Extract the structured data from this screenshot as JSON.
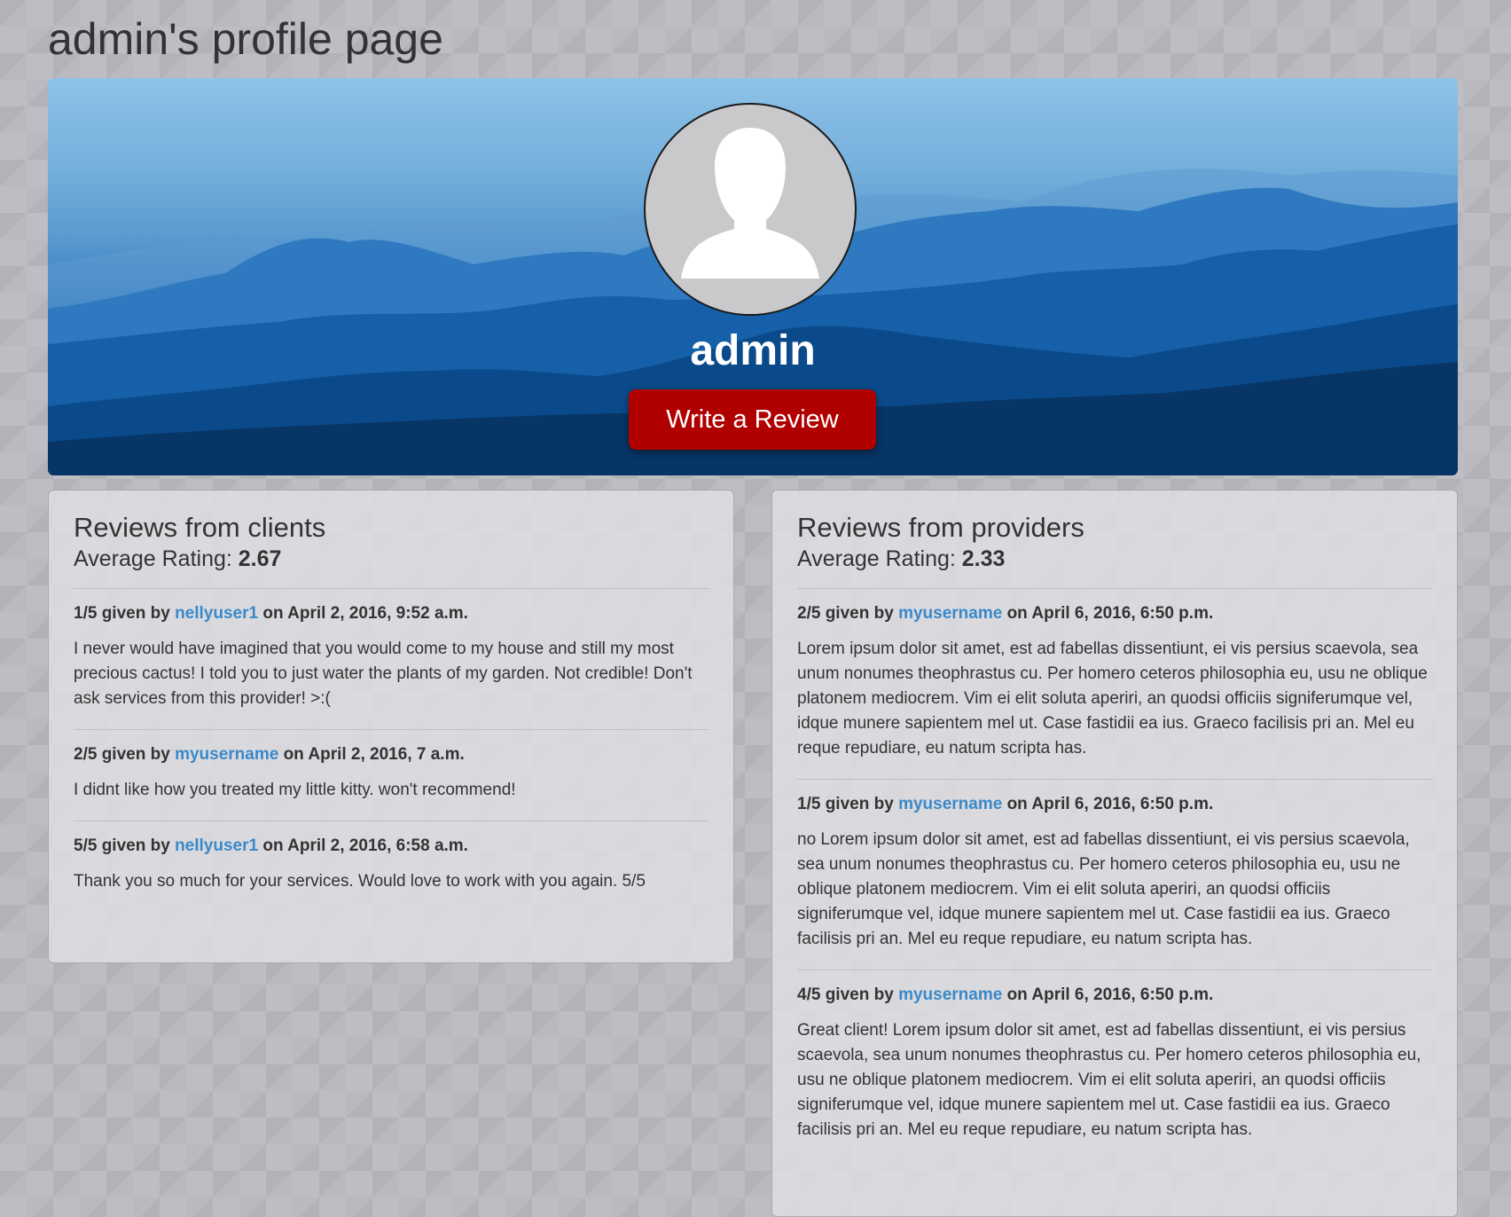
{
  "page": {
    "title": "admin's profile page"
  },
  "profile": {
    "username": "admin",
    "write_review_label": "Write a Review"
  },
  "colors": {
    "accent_button": "#b00000",
    "link": "#3a89c9",
    "banner_sky": "#8ec2e7",
    "banner_dark": "#0a3468"
  },
  "icons": {
    "avatar": "user-silhouette-icon"
  },
  "clients": {
    "heading": "Reviews from clients",
    "avg_label": "Average Rating:",
    "avg_value": "2.67",
    "reviews": [
      {
        "rating": "1/5",
        "given_by": "given by",
        "user": "nellyuser1",
        "on": "on April 2, 2016, 9:52 a.m.",
        "text": "I never would have imagined that you would come to my house and still my most precious cactus! I told you to just water the plants of my garden. Not credible! Don't ask services from this provider! >:("
      },
      {
        "rating": "2/5",
        "given_by": "given by",
        "user": "myusername",
        "on": "on April 2, 2016, 7 a.m.",
        "text": "I didnt like how you treated my little kitty. won't recommend!"
      },
      {
        "rating": "5/5",
        "given_by": "given by",
        "user": "nellyuser1",
        "on": "on April 2, 2016, 6:58 a.m.",
        "text": "Thank you so much for your services. Would love to work with you again. 5/5"
      }
    ]
  },
  "providers": {
    "heading": "Reviews from providers",
    "avg_label": "Average Rating:",
    "avg_value": "2.33",
    "reviews": [
      {
        "rating": "2/5",
        "given_by": "given by",
        "user": "myusername",
        "on": "on April 6, 2016, 6:50 p.m.",
        "text": "Lorem ipsum dolor sit amet, est ad fabellas dissentiunt, ei vis persius scaevola, sea unum nonumes theophrastus cu. Per homero ceteros philosophia eu, usu ne oblique platonem mediocrem. Vim ei elit soluta aperiri, an quodsi officiis signiferumque vel, idque munere sapientem mel ut. Case fastidii ea ius. Graeco facilisis pri an. Mel eu reque repudiare, eu natum scripta has."
      },
      {
        "rating": "1/5",
        "given_by": "given by",
        "user": "myusername",
        "on": "on April 6, 2016, 6:50 p.m.",
        "text": "no Lorem ipsum dolor sit amet, est ad fabellas dissentiunt, ei vis persius scaevola, sea unum nonumes theophrastus cu. Per homero ceteros philosophia eu, usu ne oblique platonem mediocrem. Vim ei elit soluta aperiri, an quodsi officiis signiferumque vel, idque munere sapientem mel ut. Case fastidii ea ius. Graeco facilisis pri an. Mel eu reque repudiare, eu natum scripta has."
      },
      {
        "rating": "4/5",
        "given_by": "given by",
        "user": "myusername",
        "on": "on April 6, 2016, 6:50 p.m.",
        "text": "Great client! Lorem ipsum dolor sit amet, est ad fabellas dissentiunt, ei vis persius scaevola, sea unum nonumes theophrastus cu. Per homero ceteros philosophia eu, usu ne oblique platonem mediocrem. Vim ei elit soluta aperiri, an quodsi officiis signiferumque vel, idque munere sapientem mel ut. Case fastidii ea ius. Graeco facilisis pri an. Mel eu reque repudiare, eu natum scripta has."
      }
    ]
  }
}
